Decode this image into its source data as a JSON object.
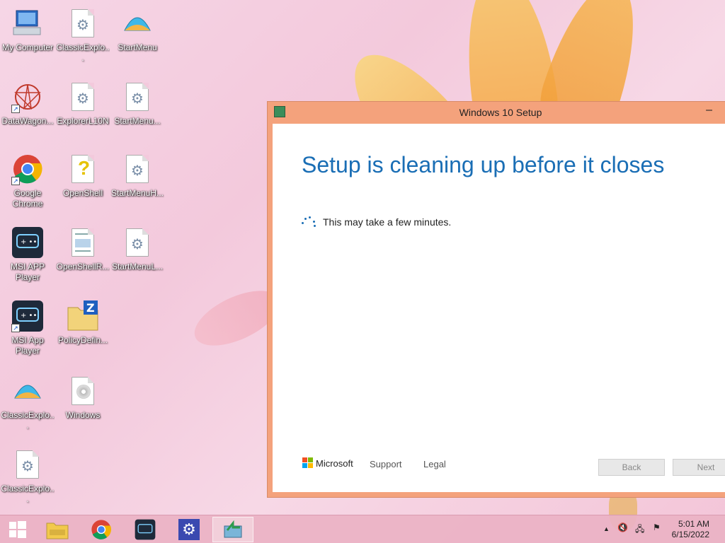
{
  "desktop": {
    "icons": [
      {
        "label": "My Computer",
        "icon": "computer-icon"
      },
      {
        "label": "ClassicExplo...",
        "icon": "settings-file-icon"
      },
      {
        "label": "StartMenu",
        "icon": "shell-icon"
      },
      {
        "label": "DataWagon...",
        "icon": "datawagon-icon"
      },
      {
        "label": "ExplorerL10N",
        "icon": "settings-file-icon"
      },
      {
        "label": "StartMenu...",
        "icon": "settings-file-icon"
      },
      {
        "label": "Google Chrome",
        "icon": "chrome-icon"
      },
      {
        "label": "OpenShell",
        "icon": "help-file-icon"
      },
      {
        "label": "StartMenuH...",
        "icon": "settings-file-icon"
      },
      {
        "label": "MSI APP Player",
        "icon": "msi-app-player-icon"
      },
      {
        "label": "OpenShellR...",
        "icon": "document-icon"
      },
      {
        "label": "StartMenuL...",
        "icon": "settings-file-icon"
      },
      {
        "label": "MSI App Player",
        "icon": "msi-app-player-icon"
      },
      {
        "label": "PolicyDefin...",
        "icon": "zip-folder-icon"
      },
      {
        "label": "ClassicExplo...",
        "icon": "shell-icon"
      },
      {
        "label": "Windows",
        "icon": "disc-file-icon"
      },
      {
        "label": "ClassicExplo...",
        "icon": "settings-file-icon"
      }
    ]
  },
  "window": {
    "title": "Windows 10 Setup",
    "heading": "Setup is cleaning up before it closes",
    "message": "This may take a few minutes.",
    "brand": "Microsoft",
    "links": {
      "support": "Support",
      "legal": "Legal"
    },
    "buttons": {
      "back": "Back",
      "next": "Next"
    }
  },
  "taskbar": {
    "time": "5:01 AM",
    "date": "6/15/2022",
    "tray_arrow": "▲"
  }
}
